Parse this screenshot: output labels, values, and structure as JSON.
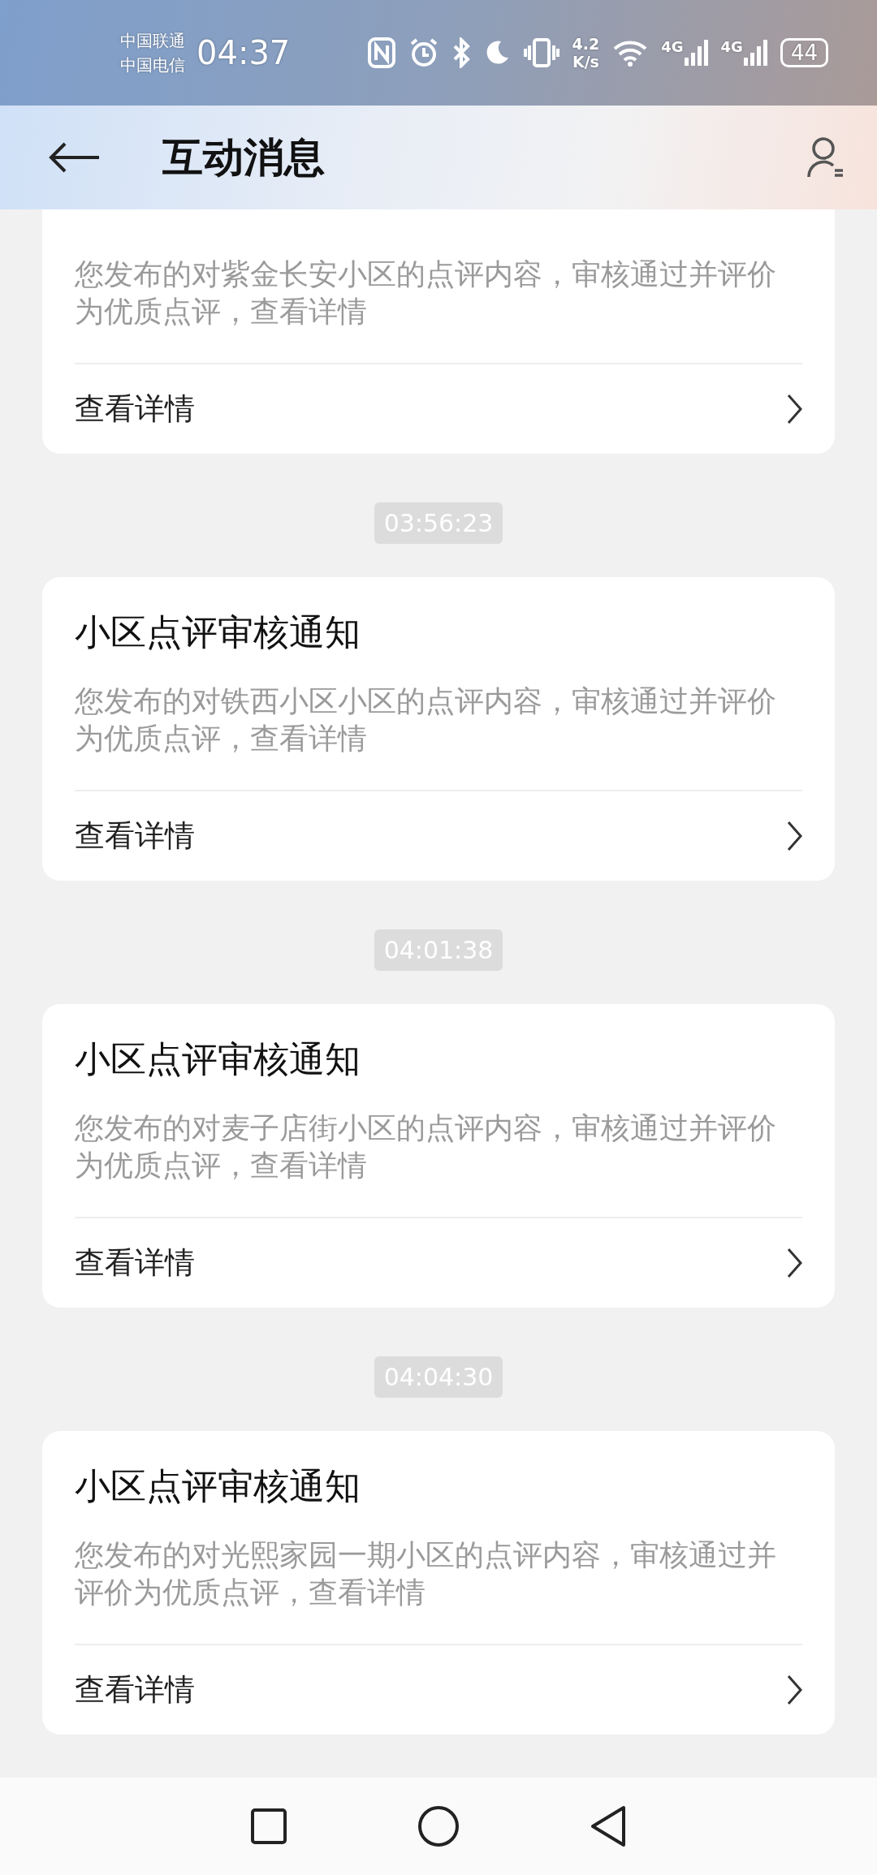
{
  "status_bar": {
    "carriers": [
      "中国联通",
      "中国电信"
    ],
    "time": "04:37",
    "speed_value": "4.2",
    "speed_unit": "K/s",
    "networks": [
      "4G",
      "4G"
    ],
    "battery": "44"
  },
  "header": {
    "title": "互动消息"
  },
  "messages": [
    {
      "body": "您发布的对紫金长安小区的点评内容，审核通过并评价为优质点评，查看详情",
      "link": "查看详情"
    },
    {
      "time": "03:56:23",
      "title": "小区点评审核通知",
      "body": "您发布的对铁西小区小区的点评内容，审核通过并评价为优质点评，查看详情",
      "link": "查看详情"
    },
    {
      "time": "04:01:38",
      "title": "小区点评审核通知",
      "body": "您发布的对麦子店街小区的点评内容，审核通过并评价为优质点评，查看详情",
      "link": "查看详情"
    },
    {
      "time": "04:04:30",
      "title": "小区点评审核通知",
      "body": "您发布的对光熙家园一期小区的点评内容，审核通过并评价为优质点评，查看详情",
      "link": "查看详情"
    }
  ]
}
